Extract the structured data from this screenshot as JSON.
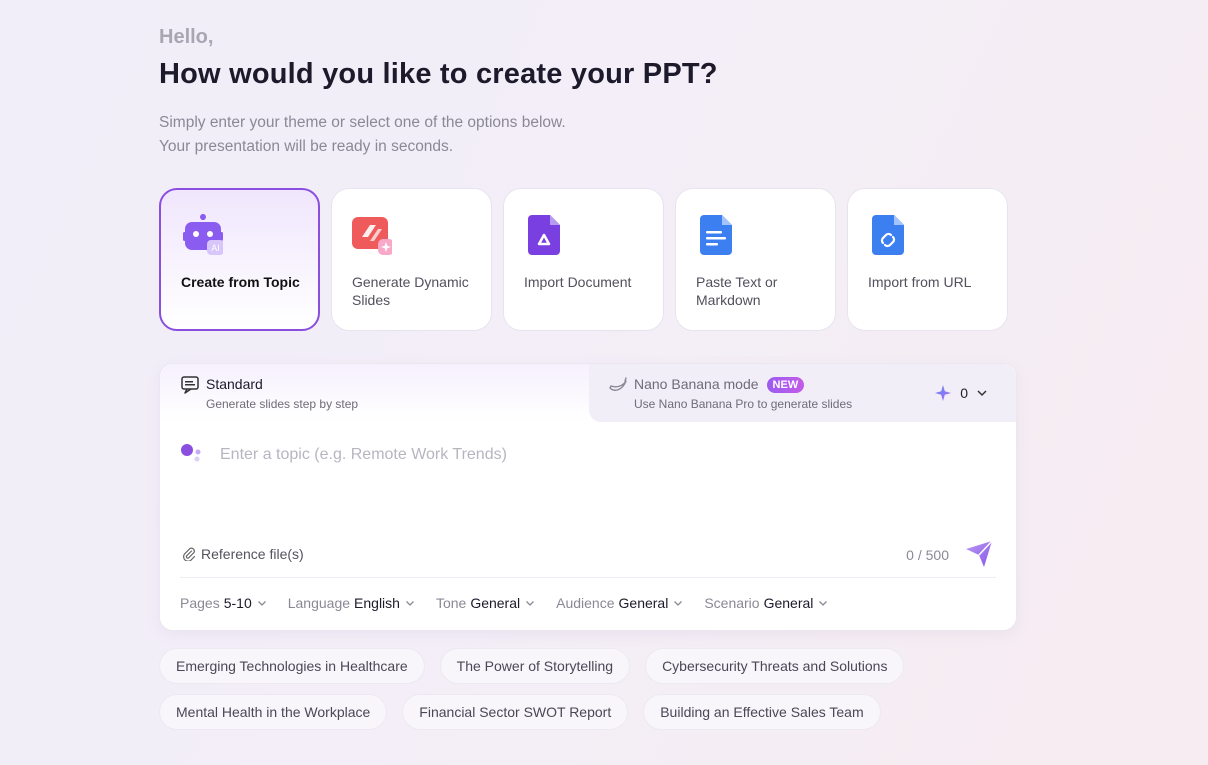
{
  "header": {
    "greeting": "Hello,",
    "title": "How would you like to create your PPT?",
    "subtitle_line1": "Simply enter your theme or select one of the options below.",
    "subtitle_line2": "Your presentation will be ready in seconds."
  },
  "cards": [
    {
      "label": "Create from Topic",
      "icon": "robot-ai-icon",
      "active": true
    },
    {
      "label": "Generate Dynamic Slides",
      "icon": "dynamic-slides-icon"
    },
    {
      "label": "Import Document",
      "icon": "document-drive-icon"
    },
    {
      "label": "Paste Text or Markdown",
      "icon": "text-document-icon"
    },
    {
      "label": "Import from URL",
      "icon": "link-document-icon"
    }
  ],
  "tabs": {
    "standard": {
      "title": "Standard",
      "desc": "Generate slides step by step"
    },
    "nano": {
      "title": "Nano Banana mode",
      "badge": "NEW",
      "desc": "Use Nano Banana Pro to generate slides"
    },
    "credits": "0"
  },
  "editor": {
    "placeholder": "Enter a topic (e.g. Remote Work Trends)",
    "reference_label": "Reference file(s)",
    "counter": "0 / 500"
  },
  "options": [
    {
      "key": "Pages",
      "value": "5-10"
    },
    {
      "key": "Language",
      "value": "English"
    },
    {
      "key": "Tone",
      "value": "General"
    },
    {
      "key": "Audience",
      "value": "General"
    },
    {
      "key": "Scenario",
      "value": "General"
    }
  ],
  "suggestions": {
    "row1": [
      "Emerging Technologies in Healthcare",
      "The Power of Storytelling",
      "Cybersecurity Threats and Solutions"
    ],
    "row2": [
      "Mental Health in the Workplace",
      "Financial Sector SWOT Report",
      "Building an Effective Sales Team"
    ]
  },
  "colors": {
    "accent": "#8b4fe0",
    "badge": "#b25cec"
  }
}
